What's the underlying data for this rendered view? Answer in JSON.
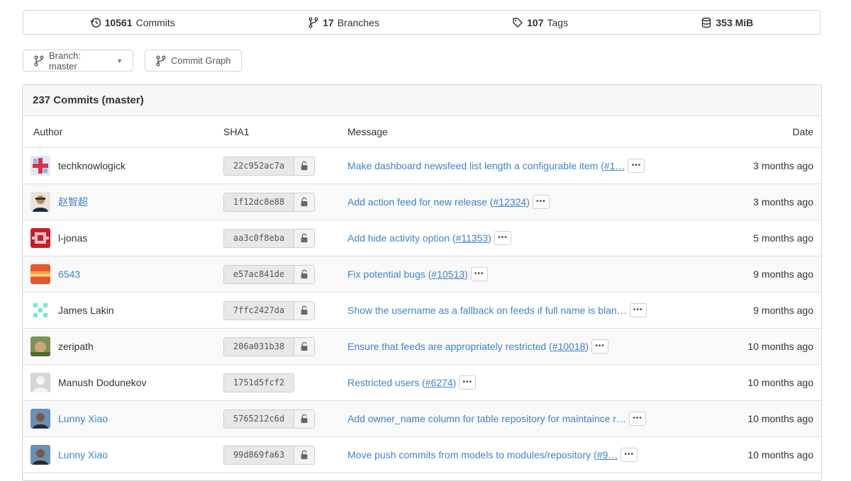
{
  "stats": {
    "commits": {
      "count": "10561",
      "label": "Commits"
    },
    "branches": {
      "count": "17",
      "label": "Branches"
    },
    "tags": {
      "count": "107",
      "label": "Tags"
    },
    "size": {
      "value": "353 MiB"
    }
  },
  "toolbar": {
    "branch_label": "Branch: master",
    "graph_label": "Commit Graph"
  },
  "panel": {
    "title": "237 Commits (master)"
  },
  "table": {
    "headers": {
      "author": "Author",
      "sha": "SHA1",
      "message": "Message",
      "date": "Date"
    },
    "rows": [
      {
        "author": "techknowlogick",
        "author_link": false,
        "sha": "22c952ac7a",
        "signed": true,
        "msg_main": "Make dashboard newsfeed list length a configurable item (",
        "msg_link": "#1…",
        "msg_end": "",
        "msg_width": 405,
        "date": "3 months ago"
      },
      {
        "author": "赵智超",
        "author_link": true,
        "sha": "1f12dc8e88",
        "signed": true,
        "msg_main": "Add action feed for new release (",
        "msg_link": "#12324",
        "msg_end": ")",
        "msg_width": 270,
        "date": "3 months ago"
      },
      {
        "author": "l-jonas",
        "author_link": false,
        "sha": "aa3c0f8eba",
        "signed": true,
        "msg_main": "Add hide activity option (",
        "msg_link": "#11353",
        "msg_end": ")",
        "msg_width": 215,
        "date": "5 months ago"
      },
      {
        "author": "6543",
        "author_link": true,
        "sha": "e57ac841de",
        "signed": true,
        "msg_main": "Fix potential bugs (",
        "msg_link": "#10513",
        "msg_end": ")",
        "msg_width": 180,
        "date": "9 months ago"
      },
      {
        "author": "James Lakin",
        "author_link": false,
        "sha": "7ffc2427da",
        "signed": true,
        "msg_main": "Show the username as a fallback on feeds if full name is blan…",
        "msg_link": "",
        "msg_end": "",
        "msg_width": 405,
        "date": "9 months ago"
      },
      {
        "author": "zeripath",
        "author_link": false,
        "sha": "206a031b38",
        "signed": true,
        "msg_main": "Ensure that feeds are appropriately restricted (",
        "msg_link": "#10018",
        "msg_end": ")",
        "msg_width": 356,
        "date": "10 months ago"
      },
      {
        "author": "Manush Dodunekov",
        "author_link": false,
        "sha": "1751d5fcf2",
        "signed": false,
        "msg_main": "Restricted users (",
        "msg_link": "#6274",
        "msg_end": ")",
        "msg_width": 162,
        "date": "10 months ago"
      },
      {
        "author": "Lunny Xiao",
        "author_link": true,
        "sha": "5765212c6d",
        "signed": true,
        "msg_main": "Add owner_name column for table repository for maintaince r…",
        "msg_link": "",
        "msg_end": "",
        "msg_width": 405,
        "date": "10 months ago"
      },
      {
        "author": "Lunny Xiao",
        "author_link": true,
        "sha": "99d869fa63",
        "signed": true,
        "msg_main": "Move push commits from models to modules/repository (",
        "msg_link": "#9…",
        "msg_end": "",
        "msg_width": 405,
        "date": "10 months ago"
      }
    ]
  },
  "colors": {
    "link": "#4183c4",
    "border": "#d4d4d5",
    "stripe": "#f9f9f9"
  }
}
